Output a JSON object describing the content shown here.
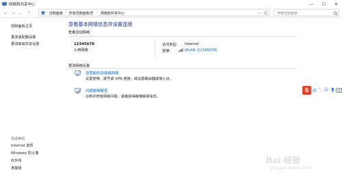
{
  "window": {
    "title": "网络和共享中心",
    "controls": {
      "minimize": "—",
      "maximize": "☐",
      "close": "✕"
    }
  },
  "nav": {
    "back": "←",
    "forward": "→",
    "up": "↑",
    "recent": "⌄",
    "breadcrumbs": [
      "控制面板",
      "所有控制面板项",
      "网络和共享中心"
    ],
    "separator": "›",
    "search_placeholder": "搜索控制面板"
  },
  "left_pane": {
    "links": [
      "控制面板主页",
      "更改适配器设置",
      "更改高级共享设置"
    ],
    "see_also_header": "另请参阅",
    "see_also": [
      "Internet 选项",
      "Windows 防火墙",
      "红外线",
      "家庭组"
    ]
  },
  "main": {
    "title": "查看基本网络信息并设置连接",
    "active_networks_header": "查看活动网络",
    "network_name": "12345678",
    "network_type": "公用网络",
    "access_type_label": "访问类型:",
    "access_type_value": "Internet",
    "connections_label": "连接:",
    "connection_value": "WLAN (12345678)",
    "change_settings_header": "更改网络设置",
    "tasks": [
      {
        "title": "设置新的连接或网络",
        "desc": "设置宽带、拨号或 VPN 连接；或设置路由器或接入点。"
      },
      {
        "title": "问题疑难解答",
        "desc": "诊断并修复网络问题，或者获得疑难解答信息。"
      }
    ]
  },
  "ime_toolbar": {
    "logo": "S",
    "items": [
      "中",
      "°,",
      "☺",
      "🎤",
      "⌨"
    ]
  },
  "watermark": {
    "text": "Bai 经验",
    "sub": "jingyan.baidu.com"
  },
  "colors": {
    "title_blue": "#1e3287",
    "link_blue": "#0066cc",
    "ime_red": "#e8412c"
  }
}
